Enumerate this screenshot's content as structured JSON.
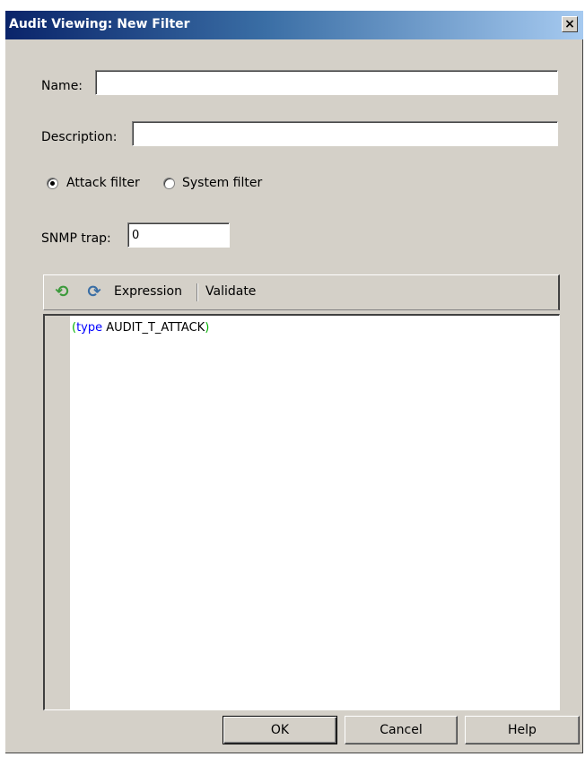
{
  "window": {
    "title": "Audit Viewing: New Filter",
    "close_glyph": "×"
  },
  "form": {
    "name_label": "Name:",
    "name_value": "",
    "description_label": "Description:",
    "description_value": "",
    "filter_type": {
      "options": [
        {
          "label": "Attack filter",
          "checked": true
        },
        {
          "label": "System filter",
          "checked": false
        }
      ]
    },
    "snmp_label": "SNMP trap:",
    "snmp_value": "0"
  },
  "toolbar": {
    "undo_icon": "undo-icon",
    "redo_icon": "redo-icon",
    "expression_label": "Expression",
    "validate_label": "Validate"
  },
  "editor": {
    "tokens": {
      "open_paren": "(",
      "keyword": "type",
      "value": " AUDIT_T_ATTACK",
      "close_paren": ")"
    },
    "colors": {
      "paren": "#00b000",
      "keyword": "#0000ff",
      "text": "#000000"
    }
  },
  "buttons": {
    "ok": "OK",
    "cancel": "Cancel",
    "help": "Help"
  }
}
